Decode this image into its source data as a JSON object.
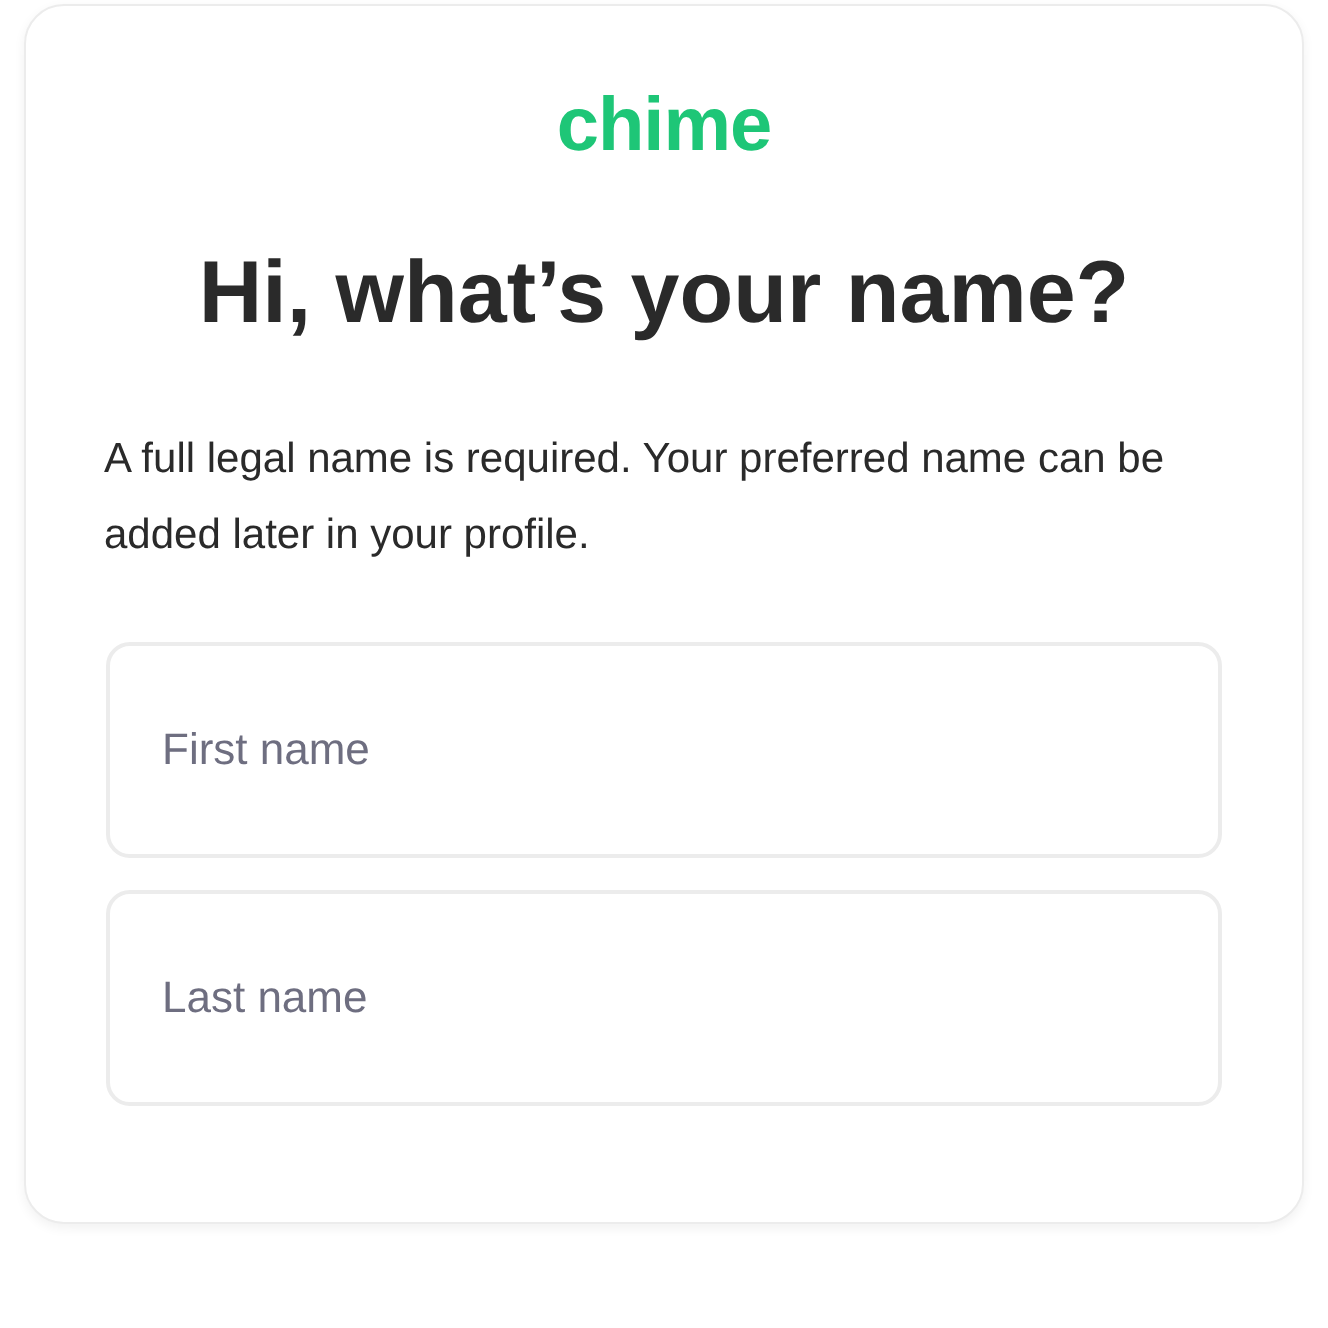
{
  "logo": {
    "text": "chime"
  },
  "heading": "Hi, what’s your name?",
  "description": "A full legal name is required. Your preferred name can be added later in your profile.",
  "fields": [
    {
      "placeholder": "First name"
    },
    {
      "placeholder": "Last name"
    }
  ]
}
